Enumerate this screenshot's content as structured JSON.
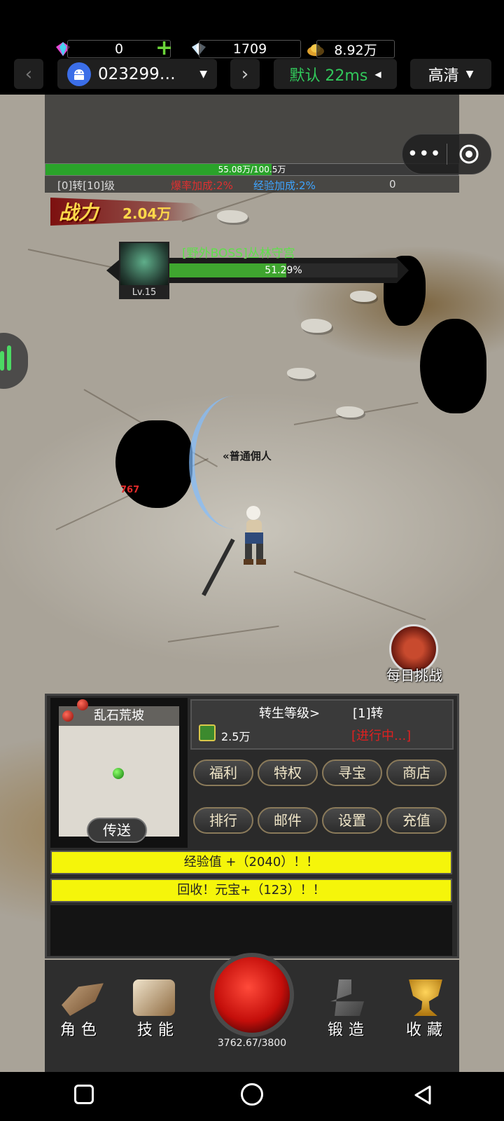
{
  "topbar": {
    "back_icon": "chevron-left-icon",
    "device_id": "023299…",
    "device_icon": "android-icon",
    "next_icon": "chevron-right-icon",
    "latency": "默认 22ms",
    "quality": "高清"
  },
  "hud": {
    "gem_count": "0",
    "diamond_count": "1709",
    "gold_count": "8.92万",
    "exp_text": "55.08万/100.5万",
    "exp_progress": 0.548,
    "level_text": "[0]转[10]级",
    "drop_bonus": "爆率加成:2%",
    "exp_bonus": "经验加成:2%",
    "extra_value": "0",
    "accent_green": "#2aa32a"
  },
  "power": {
    "label": "战力",
    "value": "2.04万"
  },
  "boss": {
    "name": "[野外BOSS]丛林守宫",
    "hp_percent_text": "51.29%",
    "hp_fraction": 0.5129,
    "level": "Lv.15"
  },
  "scene": {
    "npc_name": "«普通佣人",
    "damage_number": "767",
    "daily_challenge": "每日挑战"
  },
  "minimap": {
    "title": "乱石荒坡",
    "teleport_label": "传送"
  },
  "rebirth": {
    "title": "转生等级>",
    "level": "[1]转",
    "cost": "2.5万",
    "state": "[进行中...]"
  },
  "menu": {
    "row1": [
      "福利",
      "特权",
      "寻宝",
      "商店"
    ],
    "row2": [
      "排行",
      "邮件",
      "设置",
      "充值"
    ]
  },
  "messages": [
    "经验值 +（2040）！！",
    "回收！元宝+（123）！！"
  ],
  "bottom_nav": {
    "character": "角色",
    "skills": "技能",
    "hp_text": "3762.67/3800",
    "forge": "锻造",
    "collection": "收藏"
  },
  "colors": {
    "message_bg": "#f5f50a",
    "state_red": "#e02020",
    "boss_name": "#5ee04a"
  }
}
